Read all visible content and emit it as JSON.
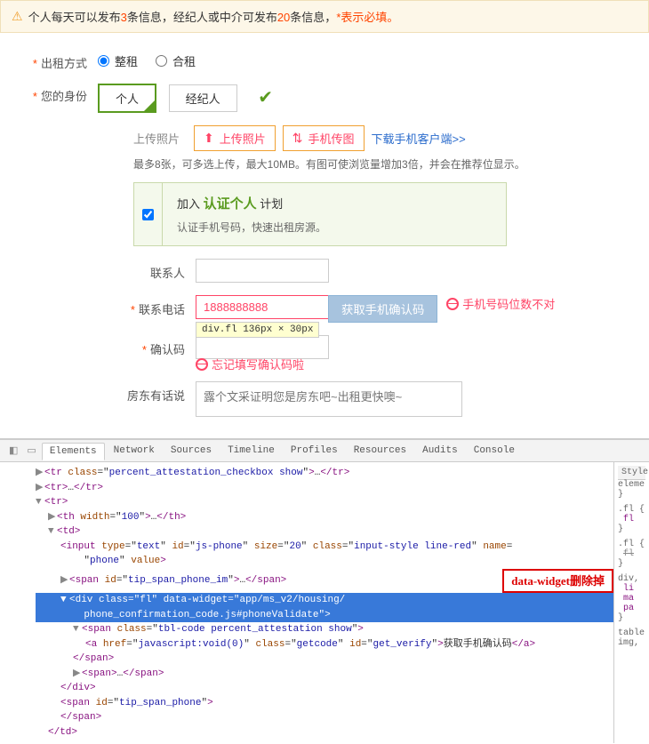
{
  "notice": {
    "p1": "个人每天可以发布",
    "n1": "3",
    "p2": "条信息，经纪人或中介可发布",
    "n2": "20",
    "p3": "条信息，",
    "p4": "*表示必填。"
  },
  "labels": {
    "rent_type": "出租方式",
    "identity": "您的身份",
    "upload": "上传照片",
    "contact": "联系人",
    "phone": "联系电话",
    "code": "确认码",
    "comment": "房东有话说"
  },
  "rent_options": {
    "whole": "整租",
    "share": "合租"
  },
  "identity_options": {
    "personal": "个人",
    "agent": "经纪人"
  },
  "upload": {
    "btn1": "上传照片",
    "btn2": "手机传图",
    "link": "下载手机客户端>>",
    "hint": "最多8张，可多选上传，最大10MB。有图可使浏览量增加3倍，并会在推荐位显示。"
  },
  "cert": {
    "join": "加入",
    "name": "认证个人",
    "plan": "计划",
    "sub": "认证手机号码，快速出租房源。"
  },
  "phone": {
    "value": "1888888888",
    "btn": "获取手机确认码",
    "err": "手机号码位数不对"
  },
  "code_err": "忘记填写确认码啦",
  "comment_placeholder": "露个文采证明您是房东吧~出租更快噢~",
  "tooltip": "div.fl 136px × 30px",
  "dt": {
    "tabs": [
      "Elements",
      "Network",
      "Sources",
      "Timeline",
      "Profiles",
      "Resources",
      "Audits",
      "Console"
    ],
    "tr1": "<tr class=\"percent_attestation_checkbox show\">…</tr>",
    "tr2": "<tr>…</tr>",
    "tr3": "<tr>",
    "th": "<th width=\"100\">…</th>",
    "td": "<td>",
    "input": "<input type=\"text\" id=\"js-phone\" size=\"20\" class=\"input-style line-red\" name=\"phone\" value>",
    "span1": "<span id=\"tip_span_phone_im\">…</span>",
    "div_open": "<div class=\"fl\" data-widget=\"app/ms_v2/housing/phone_confirmation_code.js#phoneValidate\">",
    "span2": "<span class=\"tbl-code percent_attestation show\">",
    "a": "<a href=\"javascript:void(0)\" class=\"getcode\" id=\"get_verify\">获取手机确认码</a>",
    "span2c": "</span>",
    "span3": "<span>…</span>",
    "divc": "</div>",
    "span4": "<span id=\"tip_span_phone\">",
    "span4c": "</span>",
    "tdc": "</td>",
    "annotation": "data-widget删除掉",
    "side_hdr": "Style",
    "side1": "eleme",
    "side2": "}",
    "side3": ".fl {",
    "side3b": "fl",
    "side4": "}",
    "side5": ".fl {",
    "side5b": "fl",
    "side6": "}",
    "side7": "div,",
    "side7a": "li",
    "side7b": "ma",
    "side7c": "pa",
    "side8": "}",
    "side9": "table",
    "side10": "img,"
  }
}
